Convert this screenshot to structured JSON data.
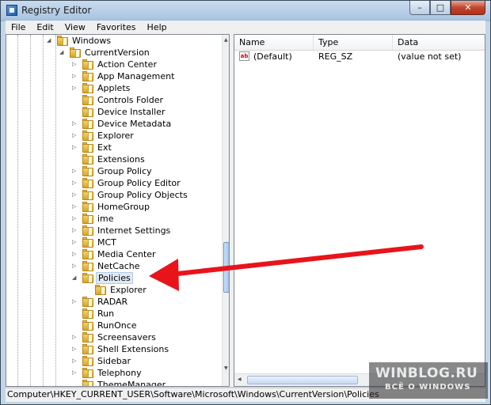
{
  "window": {
    "title": "Registry Editor",
    "minimize_glyph": "–",
    "maximize_glyph": "□",
    "close_glyph": "✕"
  },
  "menu": [
    "File",
    "Edit",
    "View",
    "Favorites",
    "Help"
  ],
  "tree": {
    "items": [
      {
        "label": "Windows",
        "expander": "◢"
      },
      {
        "label": "CurrentVersion",
        "expander": "◢"
      },
      {
        "label": "Action Center",
        "expander": "▷"
      },
      {
        "label": "App Management",
        "expander": "▷"
      },
      {
        "label": "Applets",
        "expander": "▷"
      },
      {
        "label": "Controls Folder",
        "expander": ""
      },
      {
        "label": "Device Installer",
        "expander": ""
      },
      {
        "label": "Device Metadata",
        "expander": "▷"
      },
      {
        "label": "Explorer",
        "expander": "▷"
      },
      {
        "label": "Ext",
        "expander": "▷"
      },
      {
        "label": "Extensions",
        "expander": ""
      },
      {
        "label": "Group Policy",
        "expander": "▷"
      },
      {
        "label": "Group Policy Editor",
        "expander": "▷"
      },
      {
        "label": "Group Policy Objects",
        "expander": "▷"
      },
      {
        "label": "HomeGroup",
        "expander": "▷"
      },
      {
        "label": "ime",
        "expander": "▷"
      },
      {
        "label": "Internet Settings",
        "expander": "▷"
      },
      {
        "label": "MCT",
        "expander": "▷"
      },
      {
        "label": "Media Center",
        "expander": "▷"
      },
      {
        "label": "NetCache",
        "expander": "▷"
      },
      {
        "label": "Policies",
        "expander": "◢"
      },
      {
        "label": "Explorer",
        "expander": ""
      },
      {
        "label": "RADAR",
        "expander": "▷"
      },
      {
        "label": "Run",
        "expander": ""
      },
      {
        "label": "RunOnce",
        "expander": ""
      },
      {
        "label": "Screensavers",
        "expander": "▷"
      },
      {
        "label": "Shell Extensions",
        "expander": "▷"
      },
      {
        "label": "Sidebar",
        "expander": "▷"
      },
      {
        "label": "Telephony",
        "expander": "▷"
      },
      {
        "label": "ThemeManager",
        "expander": ""
      }
    ],
    "selected": "Policies"
  },
  "list": {
    "columns": [
      "Name",
      "Type",
      "Data"
    ],
    "rows": [
      {
        "name": "(Default)",
        "type": "REG_SZ",
        "data": "(value not set)",
        "icon": "string-value-icon"
      }
    ]
  },
  "status": {
    "path": "Computer\\HKEY_CURRENT_USER\\Software\\Microsoft\\Windows\\CurrentVersion\\Policies"
  },
  "annotation": {
    "color": "#e8141a"
  },
  "watermark": {
    "line1": "WINBLOG.RU",
    "line2": "ВСЁ О WINDOWS"
  }
}
